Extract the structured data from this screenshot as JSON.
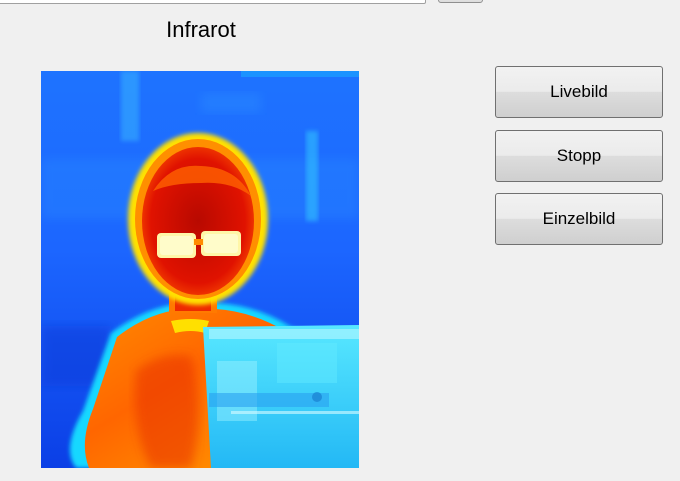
{
  "window": {
    "title": "Infrarot"
  },
  "buttons": {
    "live": "Livebild",
    "stop": "Stopp",
    "single": "Einzelbild"
  },
  "colors": {
    "background": "#f0f0f0",
    "thermal_cold": "#0a3cff",
    "thermal_cool": "#1aa8ff",
    "thermal_mid": "#35e6f2",
    "thermal_warm": "#ffd800",
    "thermal_hot": "#ff6a00",
    "thermal_hottest": "#e80f00"
  }
}
